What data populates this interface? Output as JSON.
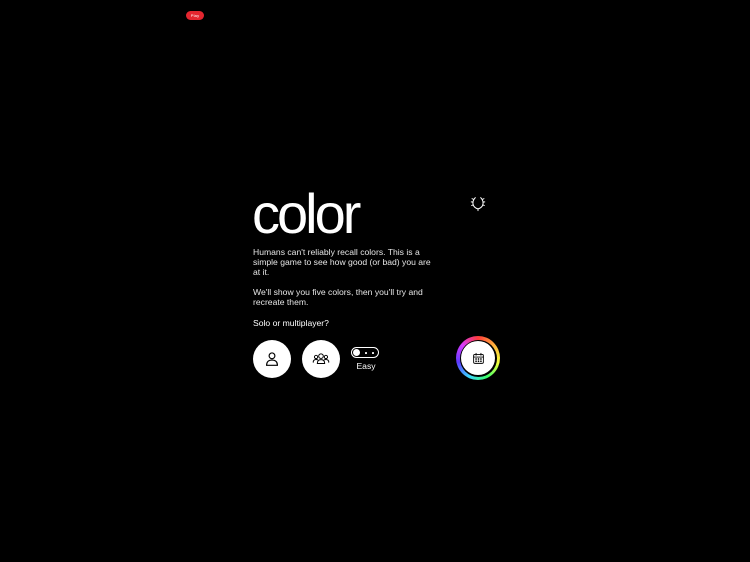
{
  "top_badge": {
    "label": "Play",
    "color": "#e3262f"
  },
  "game": {
    "title": "color",
    "description_1": "Humans can't reliably recall colors. This is a simple game to see how good (or bad) you are at it.",
    "description_2": "We'll show you five colors, then you'll try and recreate them.",
    "mode_question": "Solo or multiplayer?"
  },
  "modes": [
    {
      "id": "solo",
      "icon": "person-icon"
    },
    {
      "id": "multiplayer",
      "icon": "group-icon"
    }
  ],
  "difficulty": {
    "label": "Easy",
    "state": "off"
  },
  "daily": {
    "icon": "calendar-icon"
  },
  "achievements": {
    "icon": "laurel-icon"
  },
  "colors": {
    "background": "#000000",
    "text": "#ffffff",
    "badge": "#e3262f"
  }
}
